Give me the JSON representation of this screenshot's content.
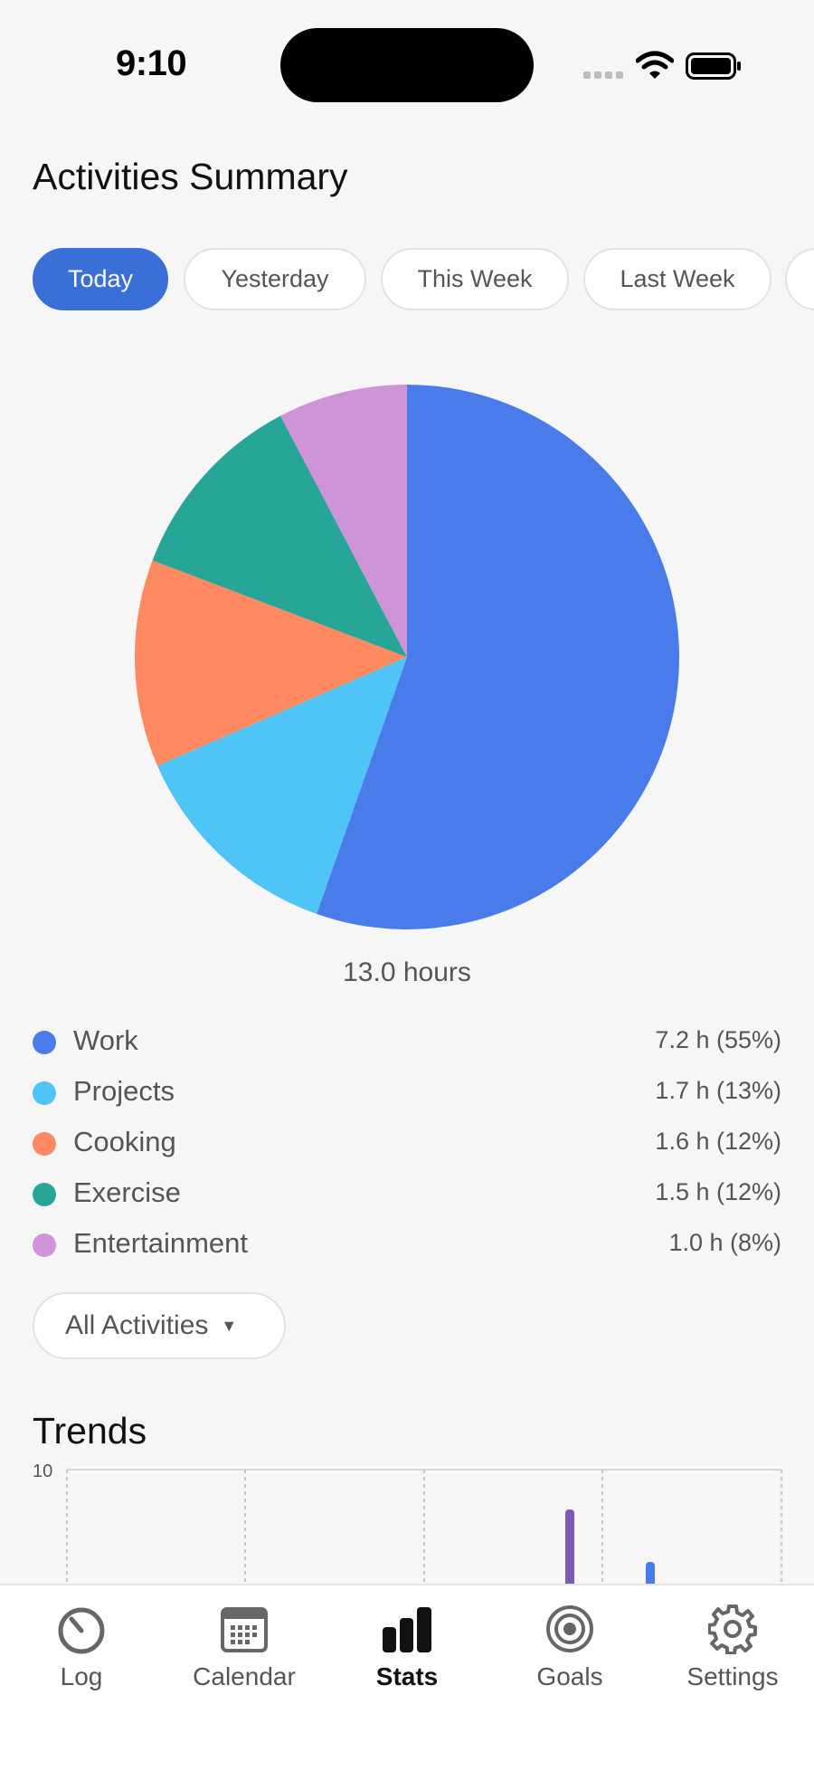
{
  "status_bar": {
    "time": "9:10"
  },
  "header": {
    "title": "Activities Summary"
  },
  "ranges": [
    {
      "label": "Today",
      "active": true
    },
    {
      "label": "Yesterday",
      "active": false
    },
    {
      "label": "This Week",
      "active": false
    },
    {
      "label": "Last Week",
      "active": false
    },
    {
      "label": "",
      "active": false
    }
  ],
  "summary": {
    "total": "13.0 hours"
  },
  "chart_data": {
    "type": "pie",
    "categories": [
      "Work",
      "Projects",
      "Cooking",
      "Exercise",
      "Entertainment"
    ],
    "values": [
      7.2,
      1.7,
      1.6,
      1.5,
      1.0
    ],
    "colors": [
      "#4a7bea",
      "#4fc4f6",
      "#ff8a62",
      "#27a596",
      "#cf93d8"
    ]
  },
  "legend": [
    {
      "label": "Work",
      "value": "7.2 h (55%)",
      "color": "#4a7bea"
    },
    {
      "label": "Projects",
      "value": "1.7 h (13%)",
      "color": "#4fc4f6"
    },
    {
      "label": "Cooking",
      "value": "1.6 h (12%)",
      "color": "#ff8a62"
    },
    {
      "label": "Exercise",
      "value": "1.5 h (12%)",
      "color": "#27a596"
    },
    {
      "label": "Entertainment",
      "value": "1.0 h (8%)",
      "color": "#cf93d8"
    }
  ],
  "filter": {
    "label": "All Activities"
  },
  "trends": {
    "title": "Trends",
    "y_max_label": "10"
  },
  "tabs": [
    {
      "label": "Log",
      "icon": "timer-icon",
      "active": false
    },
    {
      "label": "Calendar",
      "icon": "calendar-icon",
      "active": false
    },
    {
      "label": "Stats",
      "icon": "bar-chart-icon",
      "active": true
    },
    {
      "label": "Goals",
      "icon": "target-icon",
      "active": false
    },
    {
      "label": "Settings",
      "icon": "gear-icon",
      "active": false
    }
  ]
}
